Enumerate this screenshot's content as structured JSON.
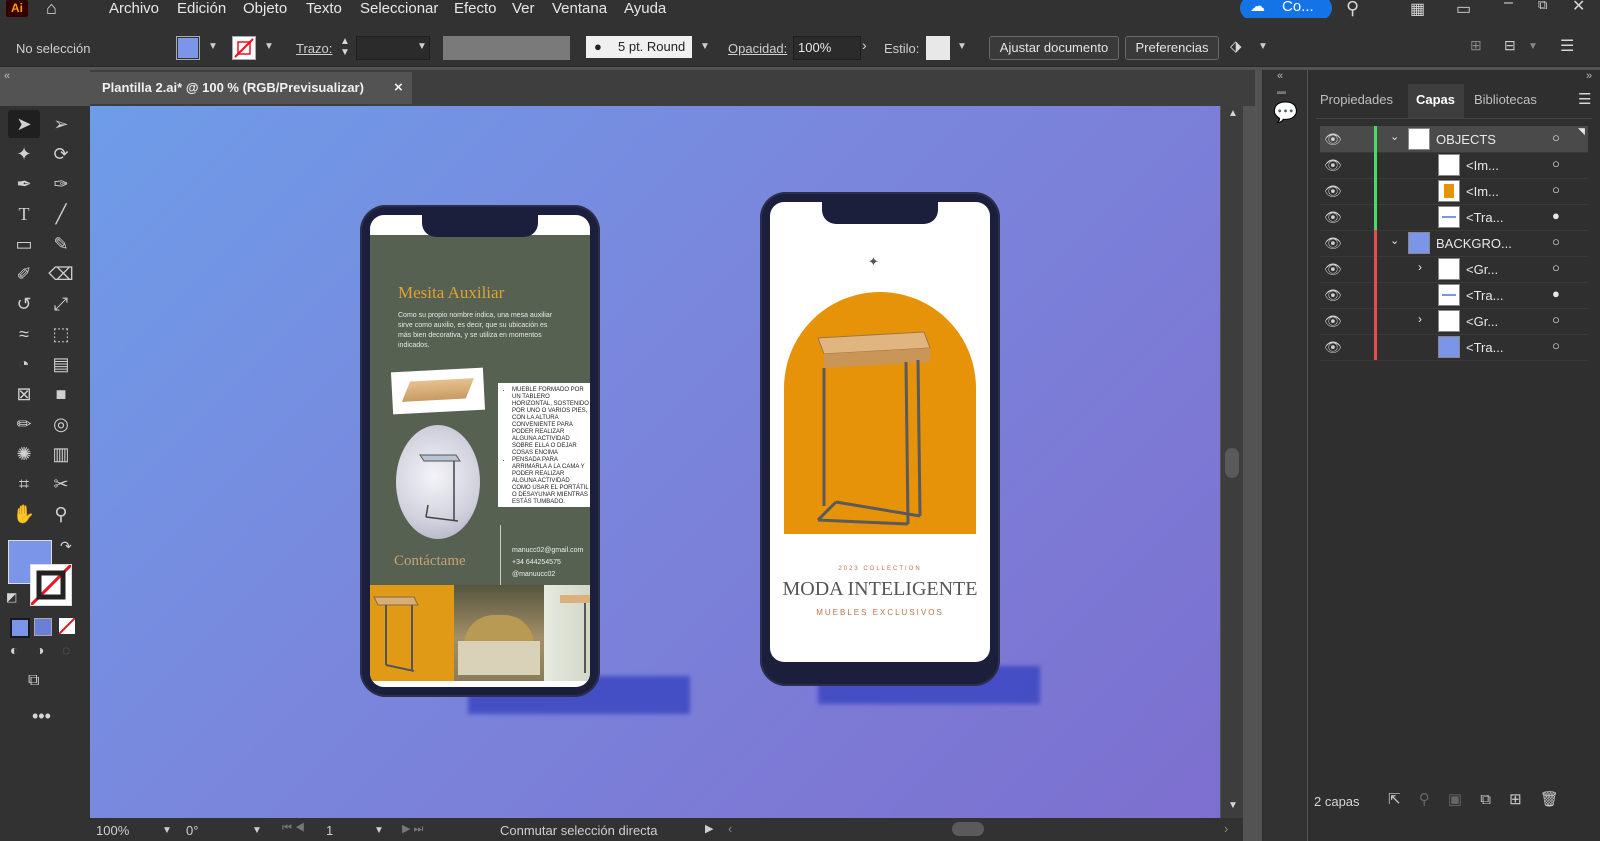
{
  "app": {
    "logo": "Ai"
  },
  "menu": [
    "Archivo",
    "Edición",
    "Objeto",
    "Texto",
    "Seleccionar",
    "Efecto",
    "Ver",
    "Ventana",
    "Ayuda"
  ],
  "cloud": {
    "label": "Co..."
  },
  "control": {
    "selection": "No selección",
    "stroke_label": "Trazo:",
    "brush": "5 pt. Round",
    "opacity_label": "Opacidad:",
    "opacity_value": "100%",
    "style_label": "Estilo:",
    "fit_doc": "Ajustar documento",
    "preferences": "Preferencias",
    "fill_color": "#7b95e8"
  },
  "document_tab": {
    "title": "Plantilla 2.ai* @ 100 % (RGB/Previsualizar)",
    "close": "×"
  },
  "canvas": {
    "phone_left": {
      "title": "Mesita Auxiliar",
      "intro": "Como su propio nombre indica, una mesa auxiliar sirve como auxilio, es decir, que su ubicación es más bien decorativa, y se utiliza en momentos indicados.",
      "bullets": [
        "MUEBLE FORMADO POR UN TABLERO HORIZONTAL, SOSTENIDO POR UNO O VARIOS PIES, CON LA ALTURA CONVENIENTE PARA PODER REALIZAR ALGUNA ACTIVIDAD SOBRE ELLA O DEJAR COSAS ENCIMA",
        "PENSADA PARA ARRIMARLA A LA CAMA Y PODER REALIZAR ALGUNA ACTIVIDAD COMO USAR EL PORTÁTIL O DESAYUNAR MIENTRAS ESTÁS TUMBADO."
      ],
      "contact_title": "Contáctame",
      "email": "manucc02@gmail.com",
      "phone": "+34 644254575",
      "handle": "@manuucc02"
    },
    "phone_right": {
      "collection": "2023 COLLECTION",
      "headline": "MODA INTELIGENTE",
      "sub": "MUEBLES EXCLUSIVOS"
    }
  },
  "status": {
    "zoom": "100%",
    "rotation": "0°",
    "artboard": "1",
    "hint": "Conmutar selección directa"
  },
  "panel": {
    "tabs": [
      "Propiedades",
      "Capas",
      "Bibliotecas"
    ],
    "layers": [
      {
        "name": "OBJECTS",
        "color": "#4cd964",
        "expanded": true
      },
      {
        "name": "<Im...",
        "color": "#4cd964"
      },
      {
        "name": "<Im...",
        "color": "#4cd964"
      },
      {
        "name": "<Tra...",
        "color": "#4cd964"
      },
      {
        "name": "BACKGRO...",
        "color": "#e84c4c",
        "expanded": true
      },
      {
        "name": "<Gr...",
        "color": "#e84c4c"
      },
      {
        "name": "<Tra...",
        "color": "#e84c4c"
      },
      {
        "name": "<Gr...",
        "color": "#e84c4c"
      },
      {
        "name": "<Tra...",
        "color": "#e84c4c"
      }
    ],
    "footer": "2 capas"
  }
}
